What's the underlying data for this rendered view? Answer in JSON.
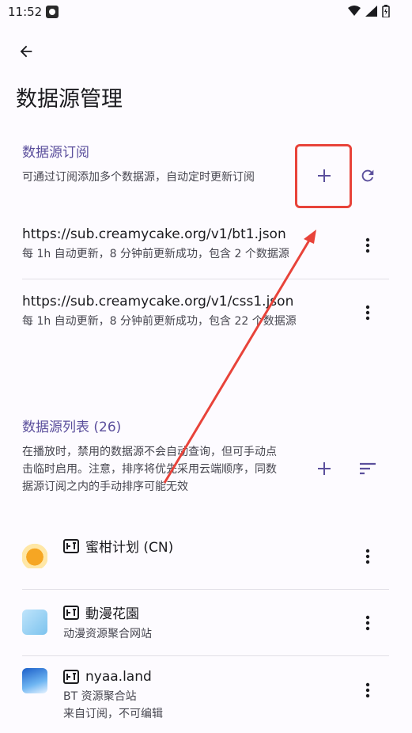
{
  "status": {
    "time": "11:52"
  },
  "header": {
    "title": "数据源管理"
  },
  "subscriptions": {
    "title": "数据源订阅",
    "description": "可通过订阅添加多个数据源，自动定时更新订阅",
    "items": [
      {
        "url": "https://sub.creamycake.org/v1/bt1.json",
        "info": "每 1h 自动更新，8 分钟前更新成功，包含 2 个数据源"
      },
      {
        "url": "https://sub.creamycake.org/v1/css1.json",
        "info": "每 1h 自动更新，8 分钟前更新成功，包含 22 个数据源"
      }
    ]
  },
  "sources": {
    "title": "数据源列表 (26)",
    "description": "在播放时，禁用的数据源不会自动查询，但可手动点击临时启用。注意，排序将优先采用云端顺序，同数据源订阅之内的手动排序可能无效",
    "items": [
      {
        "name": "蜜柑计划 (CN)",
        "subtitle": "",
        "note": ""
      },
      {
        "name": "動漫花園",
        "subtitle": "动漫资源聚合网站",
        "note": ""
      },
      {
        "name": "nyaa.land",
        "subtitle": "BT 资源聚合站",
        "note": "来自订阅，不可编辑"
      }
    ]
  },
  "colors": {
    "accent": "#5b4f9c",
    "annotation": "#e8433a"
  }
}
